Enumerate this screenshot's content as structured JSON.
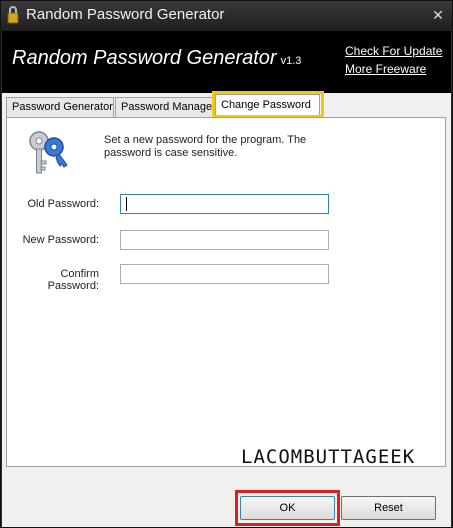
{
  "window": {
    "title": "Random Password Generator",
    "close_glyph": "✕"
  },
  "header": {
    "title": "Random Password Generator",
    "version": "v1.3",
    "links": [
      "Check For Update",
      "More Freeware"
    ]
  },
  "tabs": [
    {
      "label": "Password Generator",
      "active": false
    },
    {
      "label": "Password Manager",
      "active": false
    },
    {
      "label": "Change Password",
      "active": true
    }
  ],
  "change_password": {
    "description": "Set a new password for the program. The password is case sensitive.",
    "fields": [
      {
        "label": "Old Password:",
        "value": ""
      },
      {
        "label": "New Password:",
        "value": ""
      },
      {
        "label": "Confirm Password:",
        "value": ""
      }
    ]
  },
  "signature": "LACOMBUTTAGEEK",
  "buttons": {
    "ok": "OK",
    "reset": "Reset"
  },
  "colors": {
    "tab_highlight": "#f2c811",
    "ok_highlight": "#e02020",
    "header_bg": "#000000"
  },
  "icons": [
    "app-lock-icon",
    "keys-icon",
    "close-icon"
  ]
}
